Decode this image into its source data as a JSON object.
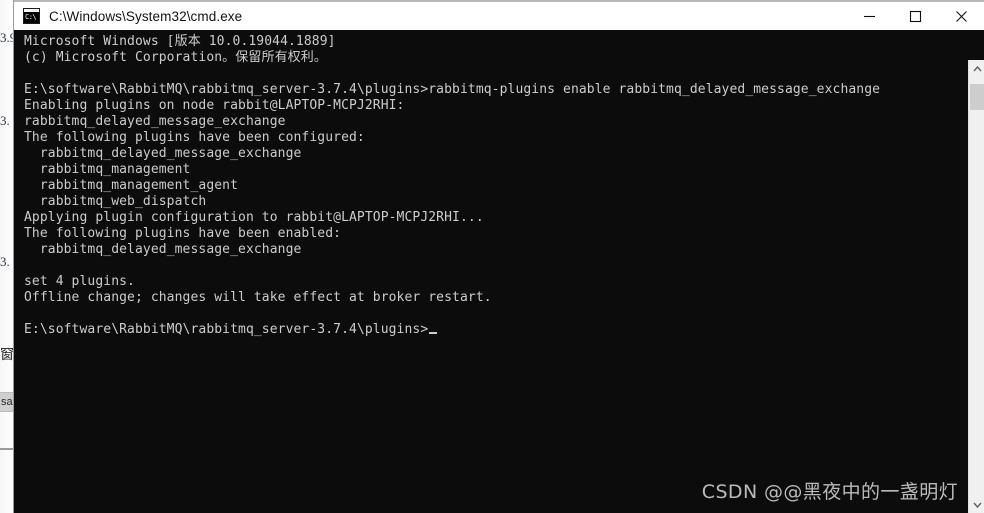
{
  "window": {
    "title": "C:\\Windows\\System32\\cmd.exe",
    "icon": "cmd-console-icon",
    "icon_prompt_text": "C:\\",
    "background_color": "#0c0c0c",
    "titlebar_color": "#ffffff",
    "text_color": "#cccccc",
    "controls": {
      "minimize_label": "Minimize",
      "maximize_label": "Maximize",
      "close_label": "Close"
    }
  },
  "terminal": {
    "lines": [
      "Microsoft Windows [版本 10.0.19044.1889]",
      "(c) Microsoft Corporation。保留所有权利。",
      "",
      "E:\\software\\RabbitMQ\\rabbitmq_server-3.7.4\\plugins>rabbitmq-plugins enable rabbitmq_delayed_message_exchange",
      "Enabling plugins on node rabbit@LAPTOP-MCPJ2RHI:",
      "rabbitmq_delayed_message_exchange",
      "The following plugins have been configured:",
      "  rabbitmq_delayed_message_exchange",
      "  rabbitmq_management",
      "  rabbitmq_management_agent",
      "  rabbitmq_web_dispatch",
      "Applying plugin configuration to rabbit@LAPTOP-MCPJ2RHI...",
      "The following plugins have been enabled:",
      "  rabbitmq_delayed_message_exchange",
      "",
      "set 4 plugins.",
      "Offline change; changes will take effect at broker restart.",
      ""
    ],
    "prompt": "E:\\software\\RabbitMQ\\rabbitmq_server-3.7.4\\plugins>",
    "command_entered": "rabbitmq-plugins enable rabbitmq_delayed_message_exchange",
    "node_name": "rabbit@LAPTOP-MCPJ2RHI",
    "plugin_count": "set 4 plugins."
  },
  "watermark": {
    "text": "CSDN @@黑夜中的一盏明灯"
  },
  "scrollbar": {
    "up_arrow": "chevron-up-icon",
    "down_arrow": "chevron-down-icon"
  },
  "backdrop": {
    "fragment_1": "3.9",
    "fragment_2": "3.",
    "fragment_3": "3.",
    "fragment_4": "窗",
    "fragment_band": "sa"
  }
}
